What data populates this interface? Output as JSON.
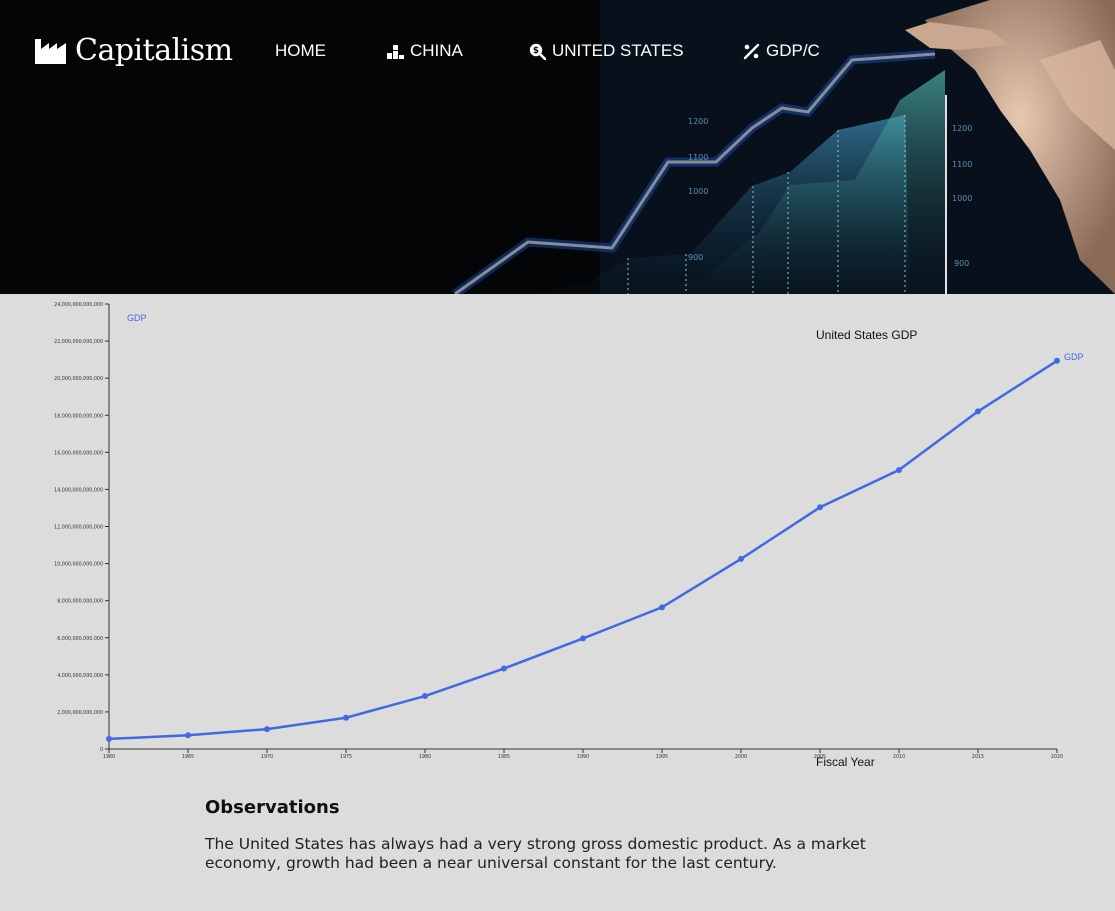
{
  "app": {
    "brand": "Capitalism",
    "nav": [
      {
        "label": "HOME",
        "icon": "none"
      },
      {
        "label": "CHINA",
        "icon": "podium-icon"
      },
      {
        "label": "UNITED STATES",
        "icon": "dollar-search-icon"
      },
      {
        "label": "GDP/C",
        "icon": "percent-icon"
      }
    ]
  },
  "colors": {
    "line": "#4169e1",
    "background": "#dcdcdc",
    "header": "#050608"
  },
  "chart_data": {
    "type": "line",
    "title": "United States GDP",
    "xlabel": "Fiscal Year",
    "ylabel": "",
    "x": [
      1960,
      1965,
      1970,
      1975,
      1980,
      1985,
      1990,
      1995,
      2000,
      2005,
      2010,
      2015,
      2020
    ],
    "series": [
      {
        "name": "GDP",
        "values": [
          543000000000,
          744000000000,
          1073000000000,
          1685000000000,
          2857000000000,
          4339000000000,
          5963000000000,
          7640000000000,
          10252000000000,
          13037000000000,
          15049000000000,
          18206000000000,
          20937000000000
        ]
      }
    ],
    "ylim": [
      0,
      24000000000000
    ],
    "yticks": [
      0,
      2000000000000,
      4000000000000,
      6000000000000,
      8000000000000,
      10000000000000,
      12000000000000,
      14000000000000,
      16000000000000,
      18000000000000,
      20000000000000,
      22000000000000,
      24000000000000
    ],
    "ytick_labels": [
      "0",
      "2,000,000,000,000",
      "4,000,000,000,000",
      "6,000,000,000,000",
      "8,000,000,000,000",
      "10,000,000,000,000",
      "12,000,000,000,000",
      "14,000,000,000,000",
      "16,000,000,000,000",
      "18,000,000,000,000",
      "20,000,000,000,000",
      "22,000,000,000,000",
      "24,000,000,000,000"
    ],
    "legend": "GDP",
    "legend_position": "top-left",
    "end_label": "GDP",
    "grid": false
  },
  "observations": {
    "heading": "Observations",
    "text": "The United States has always had a very strong gross domestic product. As a market economy, growth had been a near universal constant for the last century."
  }
}
